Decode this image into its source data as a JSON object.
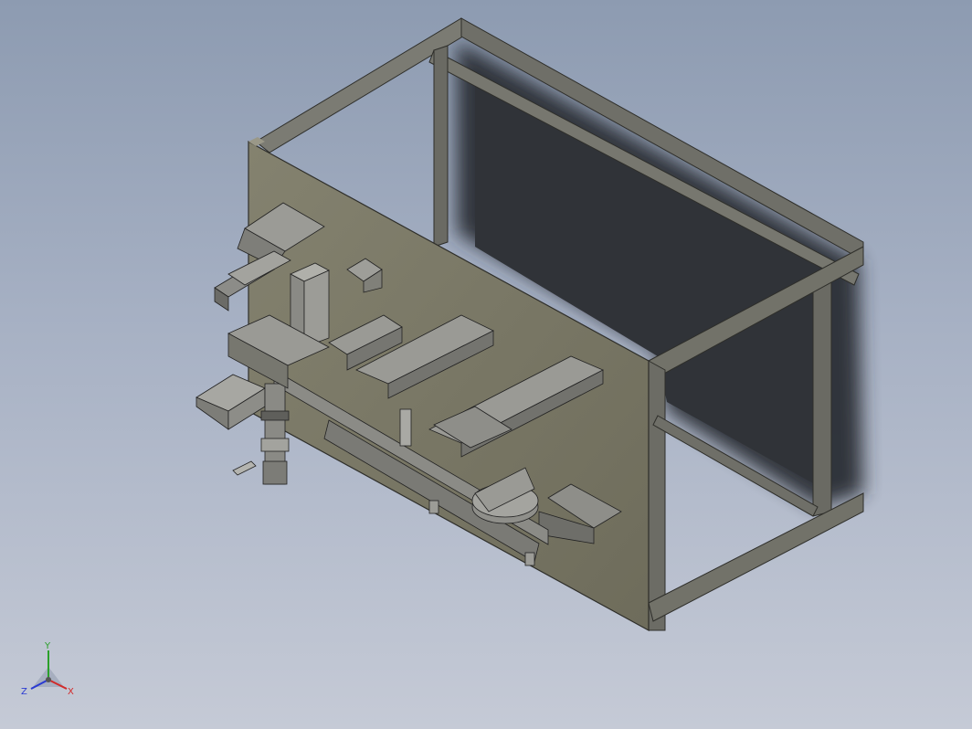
{
  "viewport": {
    "background_top": "#8d9bb1",
    "background_bottom": "#c5cad6"
  },
  "model": {
    "panel_color": "#7a7866",
    "frame_color": "#6f6f68",
    "shadow_color": "#2b2f36",
    "component_color": "#8a8a86"
  },
  "triad": {
    "x_label": "X",
    "y_label": "Y",
    "z_label": "Z",
    "x_color": "#d22a2a",
    "y_color": "#2aa02a",
    "z_color": "#2a3ad2"
  }
}
